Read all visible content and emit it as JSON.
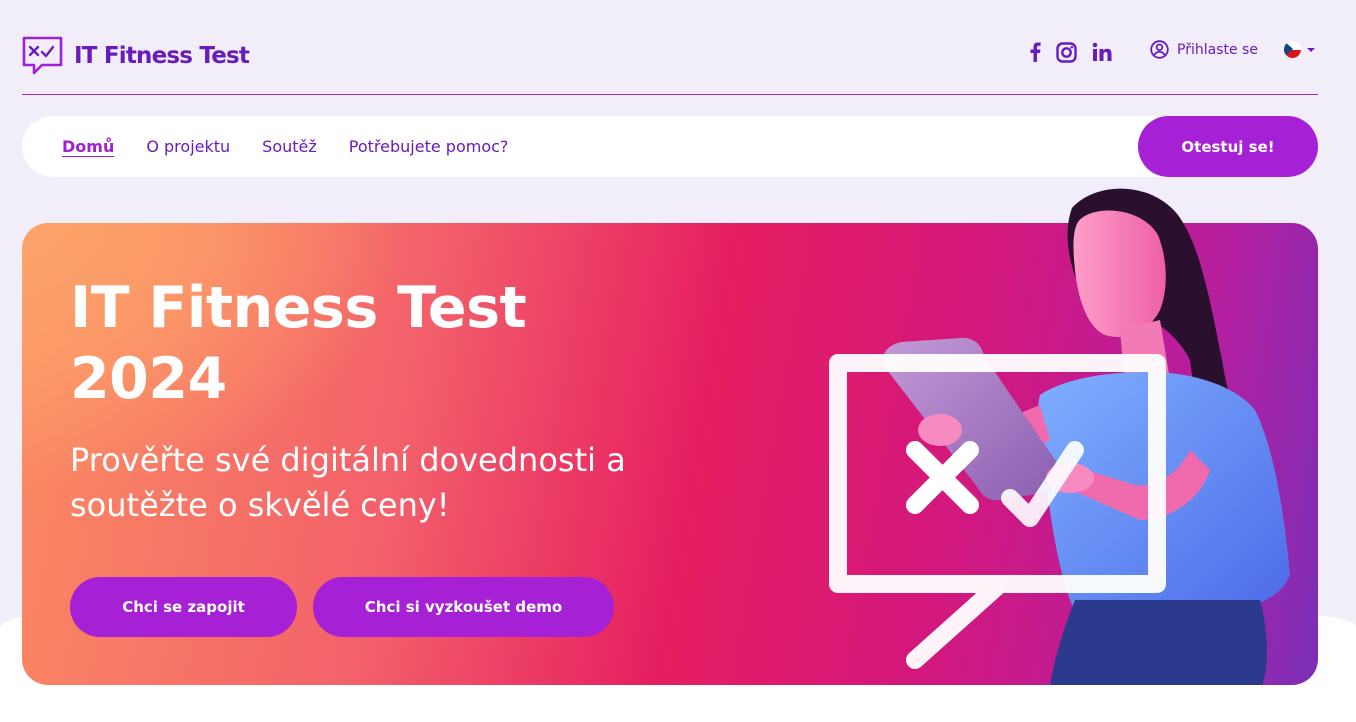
{
  "header": {
    "logo_text": "IT Fitness Test",
    "social": [
      {
        "name": "facebook-icon"
      },
      {
        "name": "instagram-icon"
      },
      {
        "name": "linkedin-icon"
      }
    ],
    "login_label": "Přihlaste se",
    "language": "cs"
  },
  "nav": {
    "items": [
      {
        "label": "Domů",
        "active": true
      },
      {
        "label": "O projektu",
        "active": false
      },
      {
        "label": "Soutěž",
        "active": false
      },
      {
        "label": "Potřebujete pomoc?",
        "active": false
      }
    ],
    "cta_label": "Otestuj se!"
  },
  "hero": {
    "title_line1": "IT Fitness Test",
    "title_line2": "2024",
    "subtitle_line1": "Prověřte své digitální dovednosti a",
    "subtitle_line2": "soutěžte o skvělé ceny!",
    "button_join": "Chci se zapojit",
    "button_demo": "Chci si vyzkoušet demo"
  },
  "colors": {
    "brand_purple": "#6a1bbd",
    "cta_purple": "#a620d6",
    "page_bg": "#f1eefa"
  }
}
